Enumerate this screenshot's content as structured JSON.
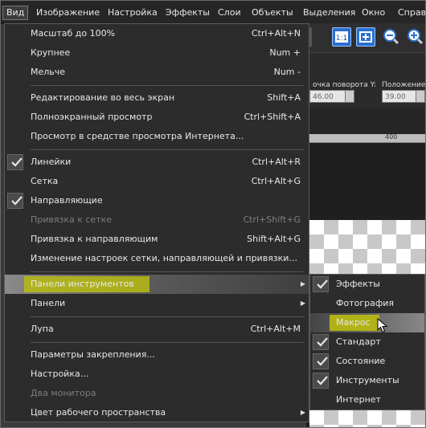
{
  "menubar": {
    "items": [
      {
        "label": "Вид",
        "active": true
      },
      {
        "label": "Изображение"
      },
      {
        "label": "Настройка"
      },
      {
        "label": "Эффекты"
      },
      {
        "label": "Слои"
      },
      {
        "label": "Объекты"
      },
      {
        "label": "Выделения"
      },
      {
        "label": "Окно"
      },
      {
        "label": "Справ"
      }
    ]
  },
  "options_bar": {
    "rotation_label": "очка поворота Y:",
    "rotation_value": "46.00",
    "position_label": "Положение X",
    "position_value": "39.00"
  },
  "ruler": {
    "tick_label": "400"
  },
  "view_menu": {
    "items": [
      {
        "label": "Масштаб до 100%",
        "shortcut": "Ctrl+Alt+N"
      },
      {
        "label": "Крупнее",
        "shortcut": "Num +"
      },
      {
        "label": "Мельче",
        "shortcut": "Num -"
      },
      {
        "label": "Редактирование во весь экран",
        "shortcut": "Shift+A"
      },
      {
        "label": "Полноэкранный просмотр",
        "shortcut": "Ctrl+Shift+A"
      },
      {
        "label": "Просмотр в средстве просмотра Интернета...",
        "shortcut": ""
      },
      {
        "label": "Линейки",
        "shortcut": "Ctrl+Alt+R",
        "checked": true
      },
      {
        "label": "Сетка",
        "shortcut": "Ctrl+Alt+G"
      },
      {
        "label": "Направляющие",
        "shortcut": "",
        "checked": true
      },
      {
        "label": "Привязка к сетке",
        "shortcut": "Ctrl+Shift+G",
        "disabled": true
      },
      {
        "label": "Привязка к направляющим",
        "shortcut": "Shift+Alt+G"
      },
      {
        "label": "Изменение настроек сетки, направляющей и привязки...",
        "shortcut": ""
      },
      {
        "label": "Панели инструментов",
        "shortcut": "",
        "submenu": true,
        "highlighted": true
      },
      {
        "label": "Панели",
        "shortcut": "",
        "submenu": true
      },
      {
        "label": "Лупа",
        "shortcut": "Ctrl+Alt+M"
      },
      {
        "label": "Параметры закрепления...",
        "shortcut": ""
      },
      {
        "label": "Настройка...",
        "shortcut": ""
      },
      {
        "label": "Два монитора",
        "shortcut": "",
        "disabled": true
      },
      {
        "label": "Цвет рабочего пространства",
        "shortcut": "",
        "submenu": true
      }
    ]
  },
  "toolbars_submenu": {
    "items": [
      {
        "label": "Эффекты",
        "checked": true
      },
      {
        "label": "Фотография",
        "checked": false
      },
      {
        "label": "Макрос",
        "checked": false,
        "highlighted": true
      },
      {
        "label": "Стандарт",
        "checked": true
      },
      {
        "label": "Состояние",
        "checked": true
      },
      {
        "label": "Инструменты",
        "checked": true
      },
      {
        "label": "Интернет",
        "checked": false
      }
    ]
  },
  "colors": {
    "highlight_yellow": "#b9bb10",
    "menu_bg": "#2c2c2c",
    "accent_blue": "#2a6fd0"
  }
}
